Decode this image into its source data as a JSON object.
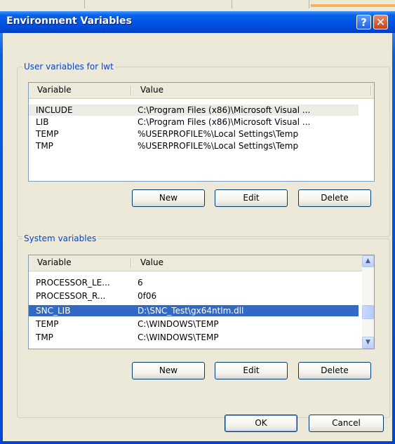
{
  "dialog": {
    "title": "Environment Variables",
    "help_label": "?",
    "close_label": "✕"
  },
  "user_group": {
    "legend": "User variables for lwt",
    "columns": [
      "Variable",
      "Value"
    ],
    "rows": [
      {
        "variable": "INCLUDE",
        "value": "C:\\Program Files (x86)\\Microsoft Visual ..."
      },
      {
        "variable": "LIB",
        "value": "C:\\Program Files (x86)\\Microsoft Visual ..."
      },
      {
        "variable": "TEMP",
        "value": "%USERPROFILE%\\Local Settings\\Temp"
      },
      {
        "variable": "TMP",
        "value": "%USERPROFILE%\\Local Settings\\Temp"
      }
    ],
    "buttons": {
      "new": "New",
      "edit": "Edit",
      "delete": "Delete"
    }
  },
  "system_group": {
    "legend": "System variables",
    "columns": [
      "Variable",
      "Value"
    ],
    "rows": [
      {
        "variable": "PROCESSOR_LE...",
        "value": "6"
      },
      {
        "variable": "PROCESSOR_R...",
        "value": "0f06"
      },
      {
        "variable": "SNC_LIB",
        "value": "D:\\SNC_Test\\gx64ntlm.dll"
      },
      {
        "variable": "TEMP",
        "value": "C:\\WINDOWS\\TEMP"
      },
      {
        "variable": "TMP",
        "value": "C:\\WINDOWS\\TEMP"
      }
    ],
    "buttons": {
      "new": "New",
      "edit": "Edit",
      "delete": "Delete"
    }
  },
  "footer": {
    "ok": "OK",
    "cancel": "Cancel"
  },
  "colors": {
    "title_bar": "#0055e6",
    "selection": "#316ac5",
    "group_legend": "#0046d5"
  }
}
